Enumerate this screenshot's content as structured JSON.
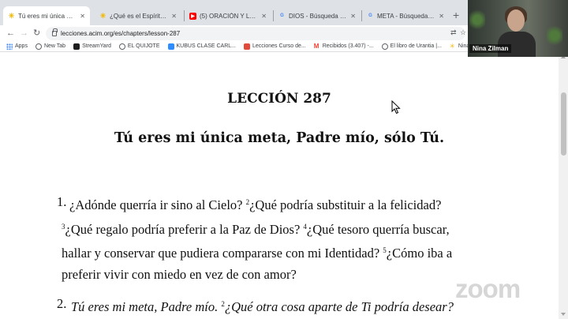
{
  "tabs": [
    {
      "title": "Tú eres mi única meta, P...",
      "favicon_color": "#f2b705",
      "favicon_glyph": "✳",
      "active": true
    },
    {
      "title": "¿Qué es el Espíritu Sant...",
      "favicon_color": "#f2b705",
      "favicon_glyph": "✳",
      "active": false
    },
    {
      "title": "(5) ORACIÓN Y LECCIÓN...",
      "favicon_color": "#ff0000",
      "favicon_glyph": "▶",
      "active": false
    },
    {
      "title": "DIOS - Búsqueda de Goo...",
      "favicon_color": "#4285f4",
      "favicon_glyph": "G",
      "active": false
    },
    {
      "title": "META - Búsqueda de Goo...",
      "favicon_color": "#4285f4",
      "favicon_glyph": "G",
      "active": false
    }
  ],
  "toolbar": {
    "url": "lecciones.acim.org/es/chapters/lesson-287",
    "back_icon": "arrow-left-icon",
    "forward_icon": "arrow-right-icon",
    "reload_icon": "reload-icon"
  },
  "bookmarks": [
    {
      "label": "Apps",
      "color": "#5f6368"
    },
    {
      "label": "New Tab",
      "color": "#5f6368"
    },
    {
      "label": "StreamYard",
      "color": "#1e1e1e"
    },
    {
      "label": "EL QUIJOTE",
      "color": "#5f6368"
    },
    {
      "label": "KUBUS CLASE CARL...",
      "color": "#2d8cff"
    },
    {
      "label": "Lecciones Curso de...",
      "color": "#e24a3b"
    },
    {
      "label": "Recibidos (3.407) -...",
      "color": "#ea4335"
    },
    {
      "label": "El libro de Urantia |...",
      "color": "#5f6368"
    },
    {
      "label": "Nina Zilma",
      "color": "#f2b705"
    }
  ],
  "lesson": {
    "heading": "LECCIÓN 287",
    "subtitle": "Tú eres mi única meta, Padre mío, sólo Tú.",
    "p1_num": "1.",
    "p1_l1": "¿Adónde querría ir sino al Cielo? ",
    "p1_s2": "2",
    "p1_l1b": "¿Qué podría substituir a la felicidad?",
    "p1_s3": "3",
    "p1_l2": "¿Qué regalo podría preferir a la Paz de Dios? ",
    "p1_s4": "4",
    "p1_l2b": "¿Qué tesoro querría buscar,",
    "p1_l3": "hallar y conservar que pudiera compararse con mi Identidad? ",
    "p1_s5": "5",
    "p1_l3b": "¿Cómo iba a",
    "p1_l4": "preferir vivir con miedo en vez de con amor?",
    "p2_num": "2.",
    "p2_l1": "Tú eres mi meta, Padre mío. ",
    "p2_s2": "2",
    "p2_l1b": "¿Qué otra cosa aparte de Ti podría desear?"
  },
  "webcam": {
    "participant_name": "Nina Zilman"
  },
  "watermark": "zoom"
}
